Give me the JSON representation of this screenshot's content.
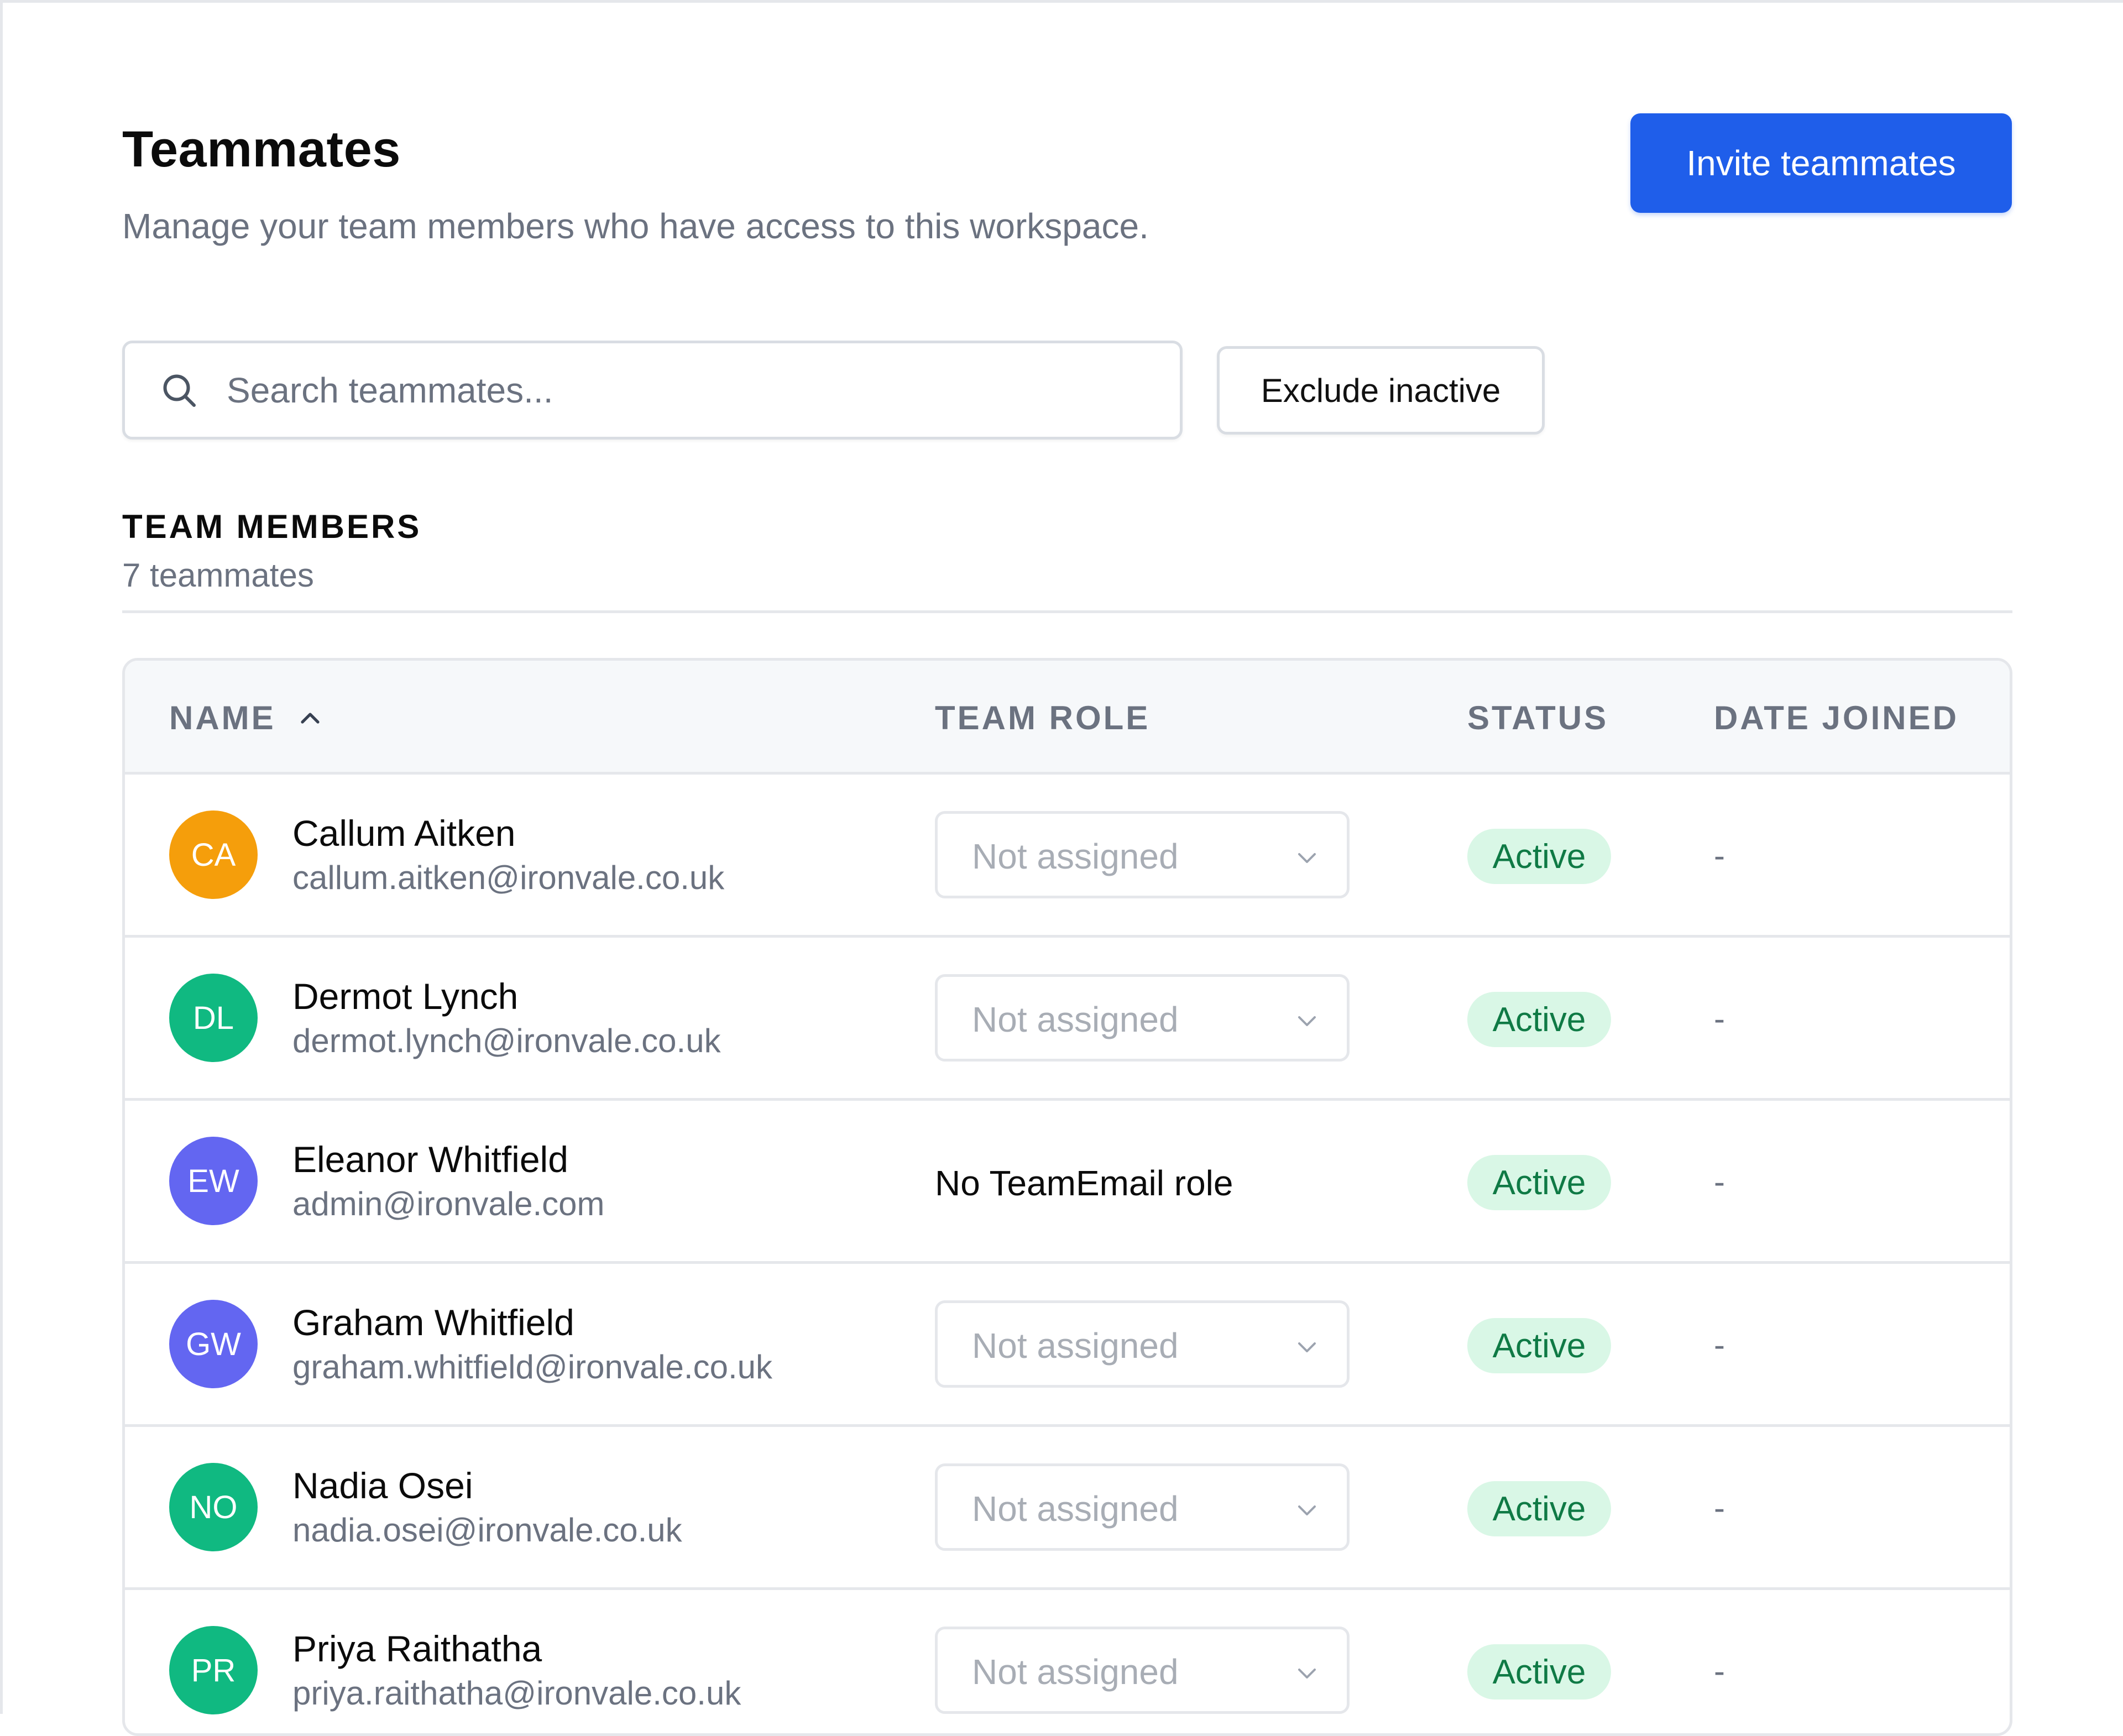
{
  "header": {
    "title": "Teammates",
    "subtitle": "Manage your team members who have access to this workspace.",
    "invite_label": "Invite teammates"
  },
  "search": {
    "placeholder": "Search teammates...",
    "value": ""
  },
  "filter": {
    "exclude_inactive_label": "Exclude inactive"
  },
  "section": {
    "label": "TEAM MEMBERS",
    "count": "7 teammates"
  },
  "table": {
    "columns": {
      "name": "NAME",
      "role": "TEAM ROLE",
      "status": "STATUS",
      "date": "DATE JOINED"
    },
    "sort": {
      "column": "name",
      "direction": "ascending"
    },
    "rows": [
      {
        "initials": "CA",
        "avatar_color": "#f59e0b",
        "name": "Callum Aitken",
        "email": "callum.aitken@ironvale.co.uk",
        "role": "Not assigned",
        "role_editable": true,
        "status": "Active",
        "date_joined": "-"
      },
      {
        "initials": "DL",
        "avatar_color": "#10b981",
        "name": "Dermot Lynch",
        "email": "dermot.lynch@ironvale.co.uk",
        "role": "Not assigned",
        "role_editable": true,
        "status": "Active",
        "date_joined": "-"
      },
      {
        "initials": "EW",
        "avatar_color": "#6366f1",
        "name": "Eleanor Whitfield",
        "email": "admin@ironvale.com",
        "role": "No TeamEmail role",
        "role_editable": false,
        "status": "Active",
        "date_joined": "-"
      },
      {
        "initials": "GW",
        "avatar_color": "#6366f1",
        "name": "Graham Whitfield",
        "email": "graham.whitfield@ironvale.co.uk",
        "role": "Not assigned",
        "role_editable": true,
        "status": "Active",
        "date_joined": "-"
      },
      {
        "initials": "NO",
        "avatar_color": "#10b981",
        "name": "Nadia Osei",
        "email": "nadia.osei@ironvale.co.uk",
        "role": "Not assigned",
        "role_editable": true,
        "status": "Active",
        "date_joined": "-"
      },
      {
        "initials": "PR",
        "avatar_color": "#10b981",
        "name": "Priya Raithatha",
        "email": "priya.raithatha@ironvale.co.uk",
        "role": "Not assigned",
        "role_editable": true,
        "status": "Active",
        "date_joined": "-"
      }
    ]
  },
  "colors": {
    "primary": "#1f5eea",
    "status_active_bg": "#d9f7e6",
    "status_active_text": "#0f7a45"
  },
  "icons": {
    "search": "search-icon",
    "sort": "chevron-up-icon",
    "select": "chevron-down-icon"
  }
}
